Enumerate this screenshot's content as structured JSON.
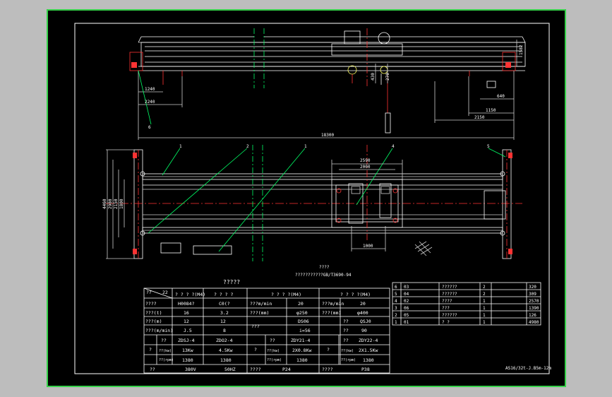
{
  "drawing": {
    "table_title": "?????",
    "subtitle_a": "????",
    "subtitle_b": "???????????GB/T3690-94",
    "drawing_code": "AS16/32t-J.B5m-12m",
    "elevation": {
      "dim_1240": "1240",
      "dim_2240": "2240",
      "dim_18300": "18300",
      "dim_640": "640",
      "dim_1150": "1150",
      "dim_2150": "2150",
      "dim_1582": "1582",
      "dim_430": "430",
      "dim_270": "270",
      "callout_6": "6"
    },
    "plan": {
      "dim_4460": "4460",
      "dim_2980": "2980",
      "dim_2150": "2150",
      "dim_1800": "1800",
      "dim_2590": "2590",
      "dim_2000": "2000",
      "dim_1000": "1000",
      "callouts": [
        "1",
        "2",
        "1",
        "4",
        "5"
      ]
    }
  },
  "spec_table": {
    "header": {
      "col_1": "??",
      "col_1b": "22",
      "col_2": "? ? ? ?(M4)",
      "col_3": "? ? ? ?",
      "col_4": "? ? ? ?(M4)",
      "col_5": "? ? ? ?(M4)"
    },
    "rows": [
      [
        "????",
        "H0084?",
        "C0(?",
        "???m/min",
        "20",
        "???m/min",
        "20"
      ],
      [
        "???(t)",
        "16",
        "3.2",
        "???(mm)",
        "φ250",
        "???(mm)",
        "φ400"
      ],
      [
        "???(m)",
        "12",
        "12",
        "???",
        "DS06",
        "??",
        "QSJ0"
      ],
      [
        "???(m/min)",
        "J.5",
        "8",
        "",
        "i=56",
        "??",
        "90"
      ]
    ],
    "motor_rows": {
      "group_label": "?",
      "row_a": [
        "??",
        "ZDSJ-4",
        "ZDO2-4",
        "??",
        "ZDY21-4",
        "??",
        "ZDY22-4"
      ],
      "row_b": [
        "??(kw)",
        "13Kw",
        "4.5Kw",
        "??(kw)",
        "2X0.8Kw",
        "??(kw)",
        "2X1.5Kw"
      ],
      "row_c": [
        "??(rpm)",
        "1380",
        "1380",
        "??(rpm)",
        "1380",
        "??(rpm)",
        "1380"
      ]
    },
    "footer": [
      "??",
      "380V",
      "50HZ",
      "????",
      "P24",
      "????",
      "P38"
    ]
  },
  "parts_list": [
    [
      "6",
      "03",
      "??????",
      "2",
      "",
      "320"
    ],
    [
      "5",
      "04",
      "??????",
      "2",
      "",
      "309"
    ],
    [
      "4",
      "02",
      "????",
      "1",
      "",
      "2570"
    ],
    [
      "3",
      "06",
      "???",
      "1",
      "",
      "1390"
    ],
    [
      "2",
      "05",
      "??????",
      "1",
      "",
      "126"
    ],
    [
      "1",
      "01",
      "? ?",
      "1",
      "",
      "4980"
    ]
  ]
}
